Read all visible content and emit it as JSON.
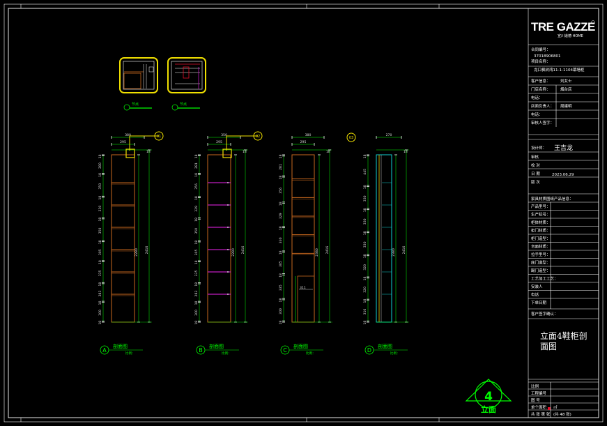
{
  "colors": {
    "background": "#000000",
    "frame": "#ffffff",
    "cabinet_outline": "#c8681e",
    "shelf_a": "#c8681e",
    "shelf_b": "#c01cc0",
    "shelf_d": "#10d0d0",
    "dimension": "#00e000",
    "highlight": "#f0e000",
    "detail_red": "#e0102a"
  },
  "logo": {
    "text": "TRE GAZZE",
    "subtitle": "宣川道德·HOME"
  },
  "titleblock": {
    "code_label": "合同编号：",
    "code_value": "37018906801",
    "project_label": "项目名称：",
    "project_value": "龙口枫树湾11-1-1104幕墙柜",
    "designer_label": "设计师：",
    "designer_value": "王吉龙",
    "fields": [
      {
        "label": "客户信息：",
        "value": "刘女士"
      },
      {
        "label": "门店名称：",
        "value": "烟台店"
      },
      {
        "label": "电话：",
        "value": ""
      },
      {
        "label": "店面负责人：",
        "value": "周建明"
      },
      {
        "label": "电话：",
        "value": ""
      },
      {
        "label": "审核人签字：",
        "value": ""
      }
    ],
    "review_rows": [
      {
        "label": "审核",
        "value": ""
      },
      {
        "label": "校 对",
        "value": ""
      },
      {
        "label": "日 期",
        "value": "2023.06.29"
      },
      {
        "label": "版 次",
        "value": ""
      }
    ],
    "product_title": "家具材质图纸产品信息：",
    "product_rows": [
      "产品型号：",
      "生产标号：",
      "柜体材质：",
      "柜门材质：",
      "柜门造型：",
      "台面材质：",
      "拉手型号：",
      "底门造型：",
      "踢门造型：",
      "工艺加工工艺：",
      "安装人",
      "电话",
      "下单日期"
    ],
    "signature_label": "客户签字确认：",
    "drawing_title_line1": "立面4鞋柜剖",
    "drawing_title_line2": "面图",
    "bottom_rows": [
      {
        "label": "比例",
        "value": ""
      },
      {
        "label": "工程编号",
        "value": ""
      },
      {
        "label": "图 号",
        "value": ""
      },
      {
        "label": "单个面积",
        "value": "㎡"
      },
      {
        "label": "共 张 第 张",
        "value": "(共 48 张)"
      }
    ]
  },
  "elevation_marker": {
    "number": "4",
    "label": "立面"
  },
  "detail_labels": [
    {
      "text": "节点",
      "scale": ""
    },
    {
      "text": "节点",
      "scale": ""
    }
  ],
  "callouts": [
    "01",
    "02",
    "03"
  ],
  "sections": [
    {
      "letter": "A",
      "title": "剖面图",
      "scale": "比例：",
      "top_dims": [
        "380",
        "295"
      ],
      "side_small": "18",
      "left_dims": [
        "18",
        "280",
        "18",
        "350",
        "18",
        "330",
        "18",
        "350",
        "18",
        "305",
        "18",
        "335",
        "18",
        "283",
        "18",
        "300",
        "18"
      ],
      "mid_dim": "2280",
      "right_dim": "2416",
      "shelves": 6,
      "shelf_color": "shelf_a"
    },
    {
      "letter": "B",
      "title": "剖面图",
      "scale": "比例：",
      "top_dims": [
        "350",
        "295"
      ],
      "side_small": "18",
      "left_dims": [
        "18",
        "281",
        "18",
        "356",
        "18",
        "329",
        "18",
        "350",
        "18",
        "305",
        "18",
        "335",
        "18",
        "283",
        "18",
        "300",
        "18"
      ],
      "mid_dim": "2280",
      "right_dim": "2416",
      "shelves": 6,
      "shelf_color": "shelf_b"
    },
    {
      "letter": "C",
      "title": "剖面图",
      "scale": "比例：",
      "top_dims": [
        "380",
        "295"
      ],
      "side_small": "18",
      "left_dims": [
        "18",
        "281",
        "18",
        "356",
        "18",
        "329",
        "18",
        "330",
        "18",
        "305",
        "18",
        "335",
        "18",
        "300",
        "18"
      ],
      "mid_dim": "2380",
      "right_dim": "2416",
      "shelves": 5,
      "shelf_color": "shelf_a",
      "note": "311"
    },
    {
      "letter": "D",
      "title": "剖面图",
      "scale": "比例：",
      "top_dims": [
        "270"
      ],
      "side_small": "18",
      "left_dims": [
        "18",
        "445",
        "18",
        "330",
        "18",
        "330",
        "18",
        "330",
        "18",
        "320",
        "18",
        "320",
        "18",
        "310",
        "18"
      ],
      "mid_dim": "2380",
      "right_dim": "2416",
      "shelves": 6,
      "shelf_color": "shelf_d"
    }
  ]
}
